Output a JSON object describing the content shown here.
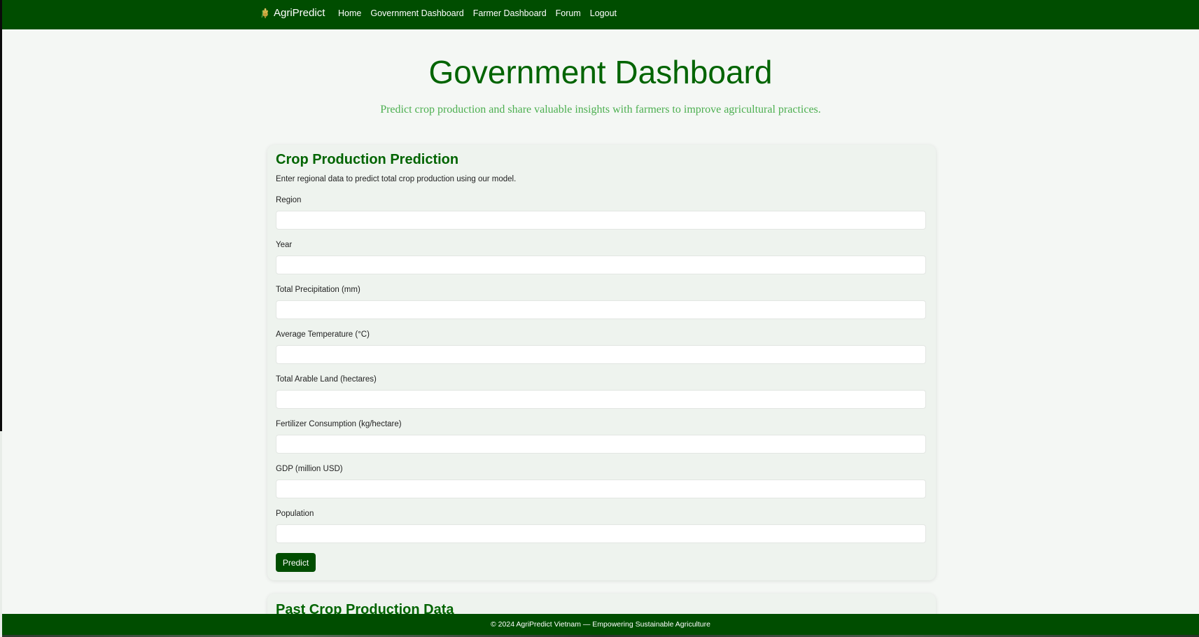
{
  "navbar": {
    "brand": "AgriPredict",
    "brand_icon": "wheat-icon",
    "links": [
      "Home",
      "Government Dashboard",
      "Farmer Dashboard",
      "Forum",
      "Logout"
    ]
  },
  "header": {
    "title": "Government Dashboard",
    "subtitle": "Predict crop production and share valuable insights with farmers to improve agricultural practices."
  },
  "prediction_card": {
    "title": "Crop Production Prediction",
    "description": "Enter regional data to predict total crop production using our model.",
    "fields": [
      {
        "label": "Region",
        "value": ""
      },
      {
        "label": "Year",
        "value": ""
      },
      {
        "label": "Total Precipitation (mm)",
        "value": ""
      },
      {
        "label": "Average Temperature (°C)",
        "value": ""
      },
      {
        "label": "Total Arable Land (hectares)",
        "value": ""
      },
      {
        "label": "Fertilizer Consumption (kg/hectare)",
        "value": ""
      },
      {
        "label": "GDP (million USD)",
        "value": ""
      },
      {
        "label": "Population",
        "value": ""
      }
    ],
    "button_label": "Predict"
  },
  "past_data_card": {
    "title": "Past Crop Production Data"
  },
  "footer": {
    "text": "© 2024 AgriPredict Vietnam — Empowering Sustainable Agriculture"
  },
  "colors": {
    "primary_dark_green": "#004d00",
    "title_green": "#006400",
    "subtitle_green": "#4caf50",
    "background": "#f4f7f4"
  }
}
